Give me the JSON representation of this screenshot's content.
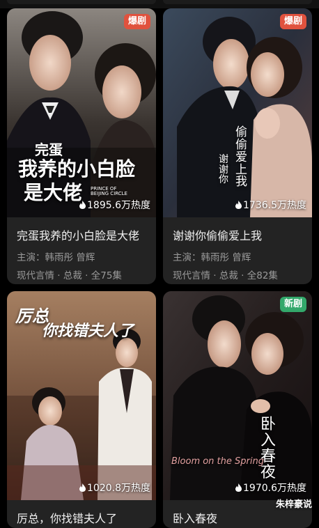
{
  "cards": [
    {
      "badge": "爆剧",
      "heat": "1895.6万热度",
      "title": "完蛋我养的小白脸是大佬",
      "cast": "主演：韩雨彤 曾辉",
      "tags": "现代言情 · 总裁 · 全75集",
      "poster_line1": "完蛋",
      "poster_line2": "我养的小白脸",
      "poster_line3": "是大佬",
      "poster_en": "PRINCE OF BEIJING CIRCLE"
    },
    {
      "badge": "爆剧",
      "heat": "1736.5万热度",
      "title": "谢谢你偷偷爱上我",
      "cast": "主演：韩雨彤 曾辉",
      "tags": "现代言情 · 总裁 · 全82集",
      "poster_line1": "偷偷爱上我",
      "poster_line2": "谢谢你"
    },
    {
      "badge": "",
      "heat": "1020.8万热度",
      "title": "厉总，你找错夫人了",
      "poster_line1": "厉总",
      "poster_line2": "你找错夫人了"
    },
    {
      "badge": "新剧",
      "heat": "1970.6万热度",
      "title": "卧入春夜",
      "poster_line1": "卧入春夜",
      "poster_en": "Bloom on the Spring"
    }
  ],
  "watermark": "朱梓豪说",
  "colors": {
    "badge_hot": "#e0523e",
    "badge_new": "#33a86b",
    "card_bg": "#232323"
  }
}
